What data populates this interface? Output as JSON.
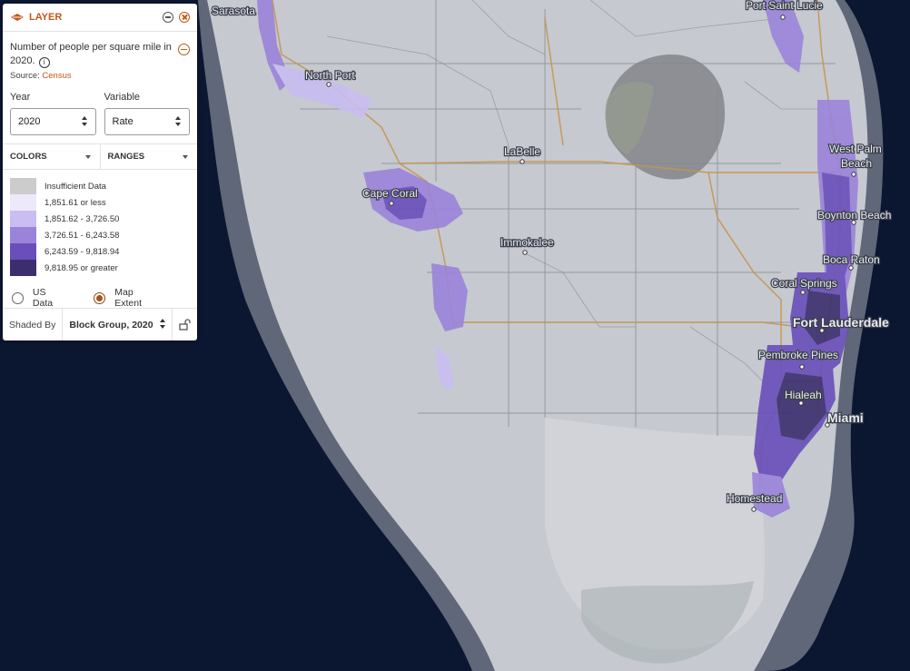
{
  "panel": {
    "header_title": "LAYER",
    "description": "Number of people per square mile in 2020.",
    "source_label": "Source:",
    "source_link": "Census",
    "year": {
      "label": "Year",
      "value": "2020"
    },
    "variable": {
      "label": "Variable",
      "value": "Rate"
    },
    "tabs": {
      "colors": "COLORS",
      "ranges": "RANGES"
    },
    "legend": [
      {
        "label": "Insufficient Data",
        "color": "#cccccc"
      },
      {
        "label": "1,851.61 or less",
        "color": "#ede9fb"
      },
      {
        "label": "1,851.62 - 3,726.50",
        "color": "#c9bdf1"
      },
      {
        "label": "3,726.51 - 6,243.58",
        "color": "#9a84d9"
      },
      {
        "label": "6,243.59 - 9,818.94",
        "color": "#6a4fba"
      },
      {
        "label": "9,818.95 or greater",
        "color": "#3c2e6e"
      }
    ],
    "extent_options": {
      "us": "US Data",
      "map": "Map Extent",
      "selected": "map"
    },
    "shaded_by": {
      "label": "Shaded By",
      "value": "Block Group, 2020"
    }
  },
  "map": {
    "ocean_color": "#0b1631",
    "land_color": "#c6c9cf",
    "accent_color": "#c2571a",
    "cities": [
      {
        "name": "Sarasota",
        "major": false
      },
      {
        "name": "Port Saint Lucie",
        "major": false
      },
      {
        "name": "North Port",
        "major": false
      },
      {
        "name": "West Palm",
        "major": false
      },
      {
        "name": "Beach",
        "major": false
      },
      {
        "name": "LaBelle",
        "major": false
      },
      {
        "name": "Cape Coral",
        "major": false
      },
      {
        "name": "Boynton Beach",
        "major": false
      },
      {
        "name": "Immokalee",
        "major": false
      },
      {
        "name": "Boca Raton",
        "major": false
      },
      {
        "name": "Coral Springs",
        "major": false
      },
      {
        "name": "Fort Lauderdale",
        "major": true
      },
      {
        "name": "Pembroke Pines",
        "major": false
      },
      {
        "name": "Hialeah",
        "major": false
      },
      {
        "name": "Miami",
        "major": true
      },
      {
        "name": "Homestead",
        "major": false
      }
    ]
  }
}
